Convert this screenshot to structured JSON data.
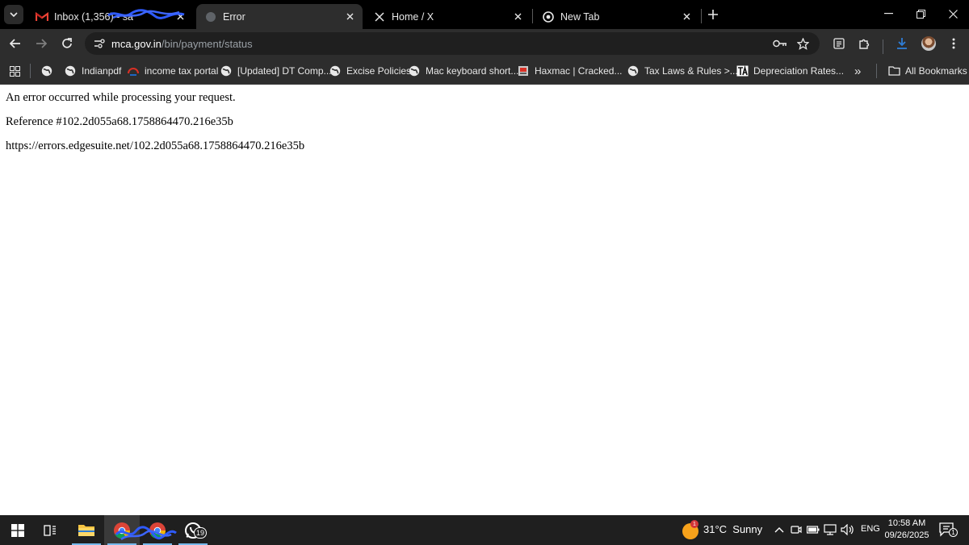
{
  "browser": {
    "tabs": [
      {
        "title": "Inbox (1,356) - sa",
        "favicon": "gmail-icon",
        "active": false
      },
      {
        "title": "Error",
        "favicon": "globe-icon",
        "active": true
      },
      {
        "title": "Home / X",
        "favicon": "x-logo-icon",
        "active": false
      },
      {
        "title": "New Tab",
        "favicon": "chrome-icon",
        "active": false
      }
    ],
    "address": {
      "host": "mca.gov.in",
      "path": "/bin/payment/status"
    },
    "bookmarks": [
      {
        "label": "",
        "icon": "globe-icon"
      },
      {
        "label": "Indianpdf",
        "icon": "globe-icon"
      },
      {
        "label": "income tax portal",
        "icon": "incometax-icon"
      },
      {
        "label": "[Updated] DT Comp...",
        "icon": "globe-icon"
      },
      {
        "label": "Excise Policies",
        "icon": "globe-icon"
      },
      {
        "label": "Mac keyboard short...",
        "icon": "globe-icon"
      },
      {
        "label": "Haxmac | Cracked...",
        "icon": "haxmac-icon"
      },
      {
        "label": "Tax Laws & Rules >...",
        "icon": "globe-icon"
      },
      {
        "label": "Depreciation Rates...",
        "icon": "ta-icon"
      }
    ],
    "all_bookmarks_label": "All Bookmarks",
    "overflow_label": "»"
  },
  "page": {
    "lines": [
      "An error occurred while processing your request.",
      "Reference #102.2d055a68.1758864470.216e35b",
      "https://errors.edgesuite.net/102.2d055a68.1758864470.216e35b"
    ]
  },
  "taskbar": {
    "whatsapp_badge": "19",
    "weather": {
      "temp": "31°C",
      "condition": "Sunny",
      "badge": "1"
    },
    "language": "ENG",
    "time": "10:58 AM",
    "date": "09/26/2025",
    "notification_count": "1"
  },
  "colors": {
    "tabstrip": "#000000",
    "toolbar": "#2d2d2d",
    "omnibox": "#1f1f1f",
    "taskbar": "#1f1f1f",
    "accent": "#76b9ed"
  }
}
